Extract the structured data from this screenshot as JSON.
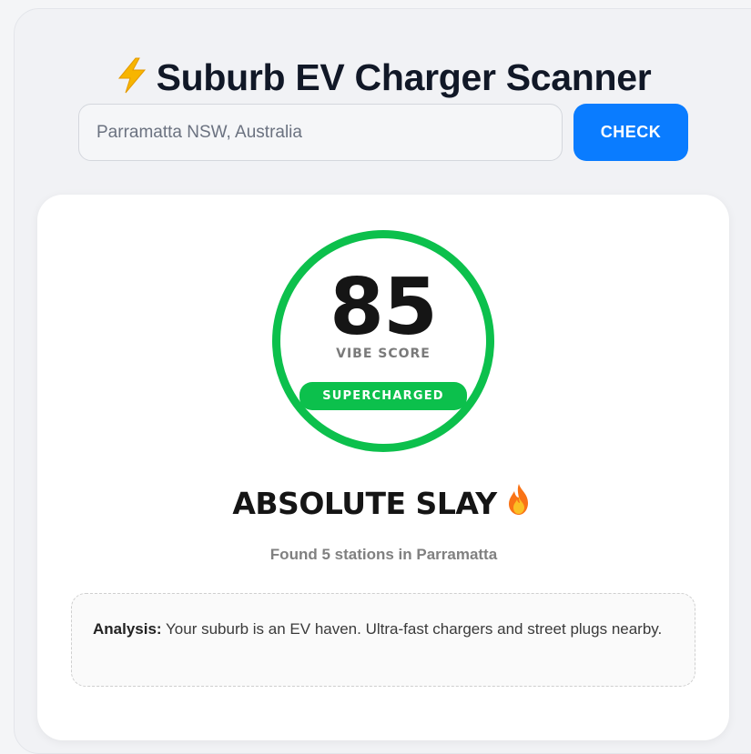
{
  "header": {
    "icon": "lightning-bolt-icon",
    "title": "Suburb EV Charger Scanner"
  },
  "search": {
    "value": "",
    "placeholder": "Parramatta NSW, Australia",
    "button_label": "CHECK"
  },
  "result": {
    "score": "85",
    "score_label": "VIBE SCORE",
    "score_fill_fraction": 0.85,
    "tier": "SUPERCHARGED",
    "verdict": "ABSOLUTE SLAY",
    "verdict_icon": "fire-icon",
    "stations_found": "Found 5 stations in Parramatta",
    "analysis_label": "Analysis:",
    "analysis_text": " Your suburb is an EV haven. Ultra-fast chargers and street plugs nearby."
  },
  "colors": {
    "accent_blue": "#0a7cff",
    "score_green": "#0cc04c",
    "title_dark": "#111827",
    "page_bg": "#f4f5f7"
  }
}
